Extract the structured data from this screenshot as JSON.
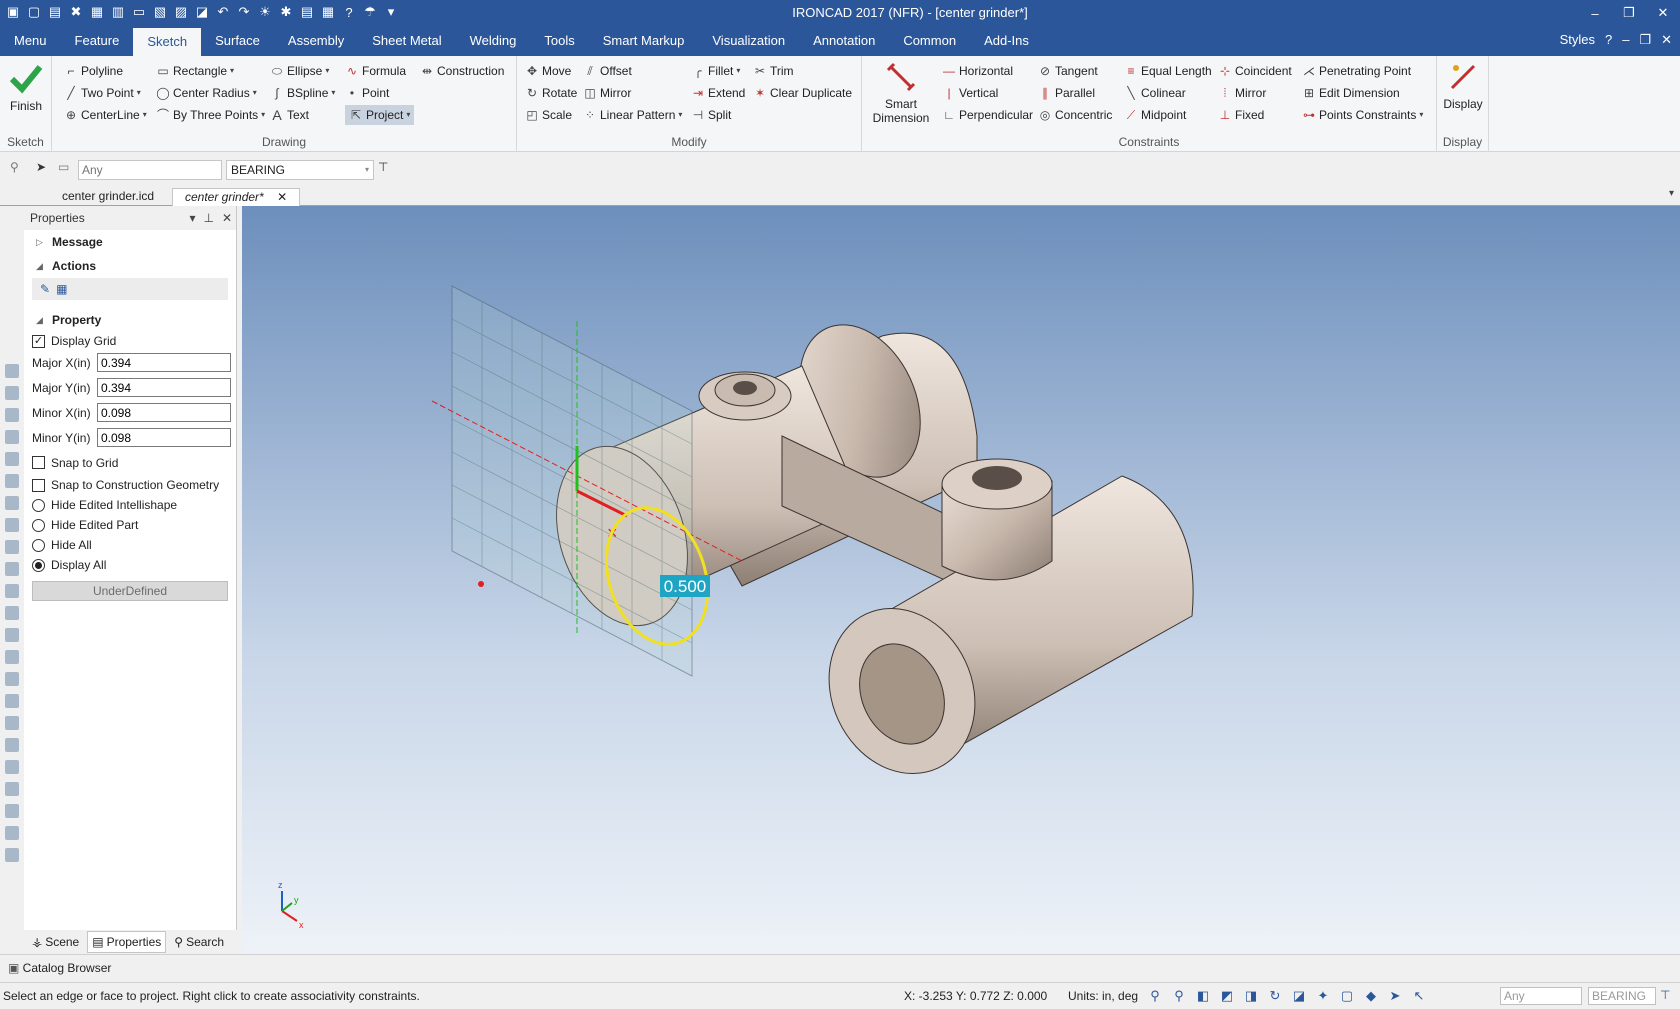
{
  "window": {
    "title": "IRONCAD 2017 (NFR) - [center grinder*]",
    "minimize": "–",
    "restore": "❐",
    "close": "✕"
  },
  "quick_access_icons": [
    "app-icon",
    "new-icon",
    "open-icon",
    "close-doc-icon",
    "save-icon",
    "print-icon",
    "folder-icon",
    "save-as-icon",
    "image-icon",
    "capture-icon",
    "undo-icon",
    "redo-icon",
    "render-icon",
    "help-icon",
    "options-icon",
    "window-icon",
    "settings-icon",
    "customize-icon"
  ],
  "menu": {
    "tabs": [
      "Menu",
      "Feature",
      "Sketch",
      "Surface",
      "Assembly",
      "Sheet Metal",
      "Welding",
      "Tools",
      "Smart Markup",
      "Visualization",
      "Annotation",
      "Common",
      "Add-Ins"
    ],
    "active": "Sketch",
    "styles": "Styles",
    "help": "?",
    "mdi_controls": [
      "–",
      "❐",
      "✕"
    ]
  },
  "ribbon": {
    "sketch_group": {
      "label": "Sketch",
      "finish": "Finish"
    },
    "drawing": {
      "label": "Drawing",
      "items": [
        "Polyline",
        "Rectangle",
        "Ellipse",
        "Formula",
        "Construction",
        "Two Point",
        "Center Radius",
        "BSpline",
        "Point",
        "CenterLine",
        "By Three Points",
        "Text",
        "Project"
      ]
    },
    "modify": {
      "label": "Modify",
      "items": [
        "Move",
        "Offset",
        "Fillet",
        "Trim",
        "Rotate",
        "Mirror",
        "Extend",
        "Clear Duplicate",
        "Scale",
        "Linear Pattern",
        "Split"
      ]
    },
    "constraints": {
      "label": "Constraints",
      "smart_dimension": [
        "Smart",
        "Dimension"
      ],
      "items": [
        "Horizontal",
        "Tangent",
        "Equal Length",
        "Coincident",
        "Penetrating Point",
        "Vertical",
        "Parallel",
        "Colinear",
        "Mirror",
        "Edit Dimension",
        "Perpendicular",
        "Concentric",
        "Midpoint",
        "Fixed",
        "Points Constraints"
      ]
    },
    "display": {
      "label": "Display",
      "button": "Display"
    }
  },
  "toolbar2": {
    "filter_placeholder": "Any",
    "part_name": "BEARING"
  },
  "doc_tabs": [
    "center grinder.icd",
    "center grinder*"
  ],
  "properties": {
    "title": "Properties",
    "sections": {
      "message": "Message",
      "actions": "Actions",
      "property": "Property"
    },
    "display_grid": "Display Grid",
    "fields": [
      {
        "label": "Major X(in)",
        "value": "0.394"
      },
      {
        "label": "Major Y(in)",
        "value": "0.394"
      },
      {
        "label": "Minor X(in)",
        "value": "0.098"
      },
      {
        "label": "Minor Y(in)",
        "value": "0.098"
      }
    ],
    "snap_grid": "Snap to Grid",
    "snap_construction": "Snap to Construction Geometry",
    "radios": [
      "Hide Edited Intellishape",
      "Hide Edited Part",
      "Hide All",
      "Display All"
    ],
    "selected_radio": "Display All",
    "status_button": "UnderDefined"
  },
  "bottom_tabs": [
    "Scene",
    "Properties",
    "Search"
  ],
  "viewport": {
    "dimension_value": "0.500",
    "axis": {
      "x": "x",
      "y": "y",
      "z": "z"
    },
    "colors": {
      "ellipse": "#f0e020",
      "dimension_bg": "#1fa4c4",
      "axis_x": "#e02020",
      "axis_y": "#20c020"
    }
  },
  "catalog_browser": "Catalog Browser",
  "status": {
    "message": "Select an edge or face to project.  Right click to create associativity constraints.",
    "coords": "X: -3.253 Y: 0.772 Z: 0.000",
    "units": "Units: in, deg",
    "filter": "Any",
    "part": "BEARING"
  },
  "accent_color": "#2b579a"
}
